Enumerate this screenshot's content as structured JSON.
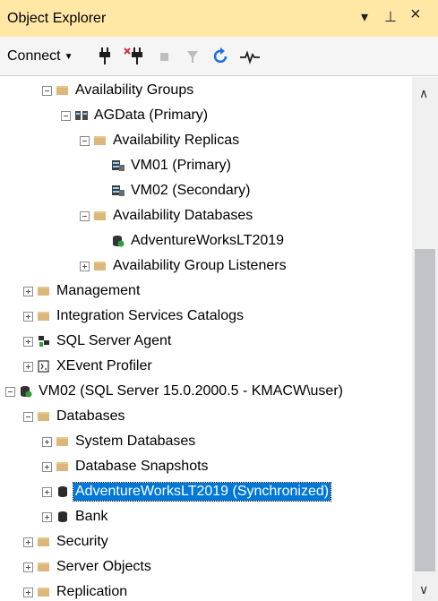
{
  "window": {
    "title": "Object Explorer",
    "controls": {
      "dropdown": "▾",
      "pin": "⊥",
      "close": "×"
    }
  },
  "toolbar": {
    "connect_label": "Connect",
    "icons": [
      "connect-icon",
      "disconnect-icon",
      "stop-icon",
      "filter-icon",
      "refresh-icon",
      "activity-monitor-icon"
    ]
  },
  "tree": {
    "rows": [
      {
        "label": "Availability Groups",
        "icon": "folder"
      },
      {
        "label": "AGData (Primary)",
        "icon": "ag"
      },
      {
        "label": "Availability Replicas",
        "icon": "folder"
      },
      {
        "label": "VM01 (Primary)",
        "icon": "replica"
      },
      {
        "label": "VM02 (Secondary)",
        "icon": "replica"
      },
      {
        "label": "Availability Databases",
        "icon": "folder"
      },
      {
        "label": "AdventureWorksLT2019",
        "icon": "avdb"
      },
      {
        "label": "Availability Group Listeners",
        "icon": "folder"
      },
      {
        "label": "Management",
        "icon": "folder"
      },
      {
        "label": "Integration Services Catalogs",
        "icon": "folder"
      },
      {
        "label": "SQL Server Agent",
        "icon": "agent"
      },
      {
        "label": "XEvent Profiler",
        "icon": "xevent"
      },
      {
        "label": "VM02 (SQL Server 15.0.2000.5 - KMACW\\user)",
        "icon": "server"
      },
      {
        "label": "Databases",
        "icon": "folder"
      },
      {
        "label": "System Databases",
        "icon": "folder"
      },
      {
        "label": "Database Snapshots",
        "icon": "folder"
      },
      {
        "label": "AdventureWorksLT2019 (Synchronized)",
        "icon": "db",
        "selected": true
      },
      {
        "label": "Bank",
        "icon": "db"
      },
      {
        "label": "Security",
        "icon": "folder"
      },
      {
        "label": "Server Objects",
        "icon": "folder"
      },
      {
        "label": "Replication",
        "icon": "folder"
      }
    ]
  },
  "colors": {
    "titlebar": "#ffe8a6",
    "selection": "#0078d7",
    "folder": "#dcb67a"
  }
}
